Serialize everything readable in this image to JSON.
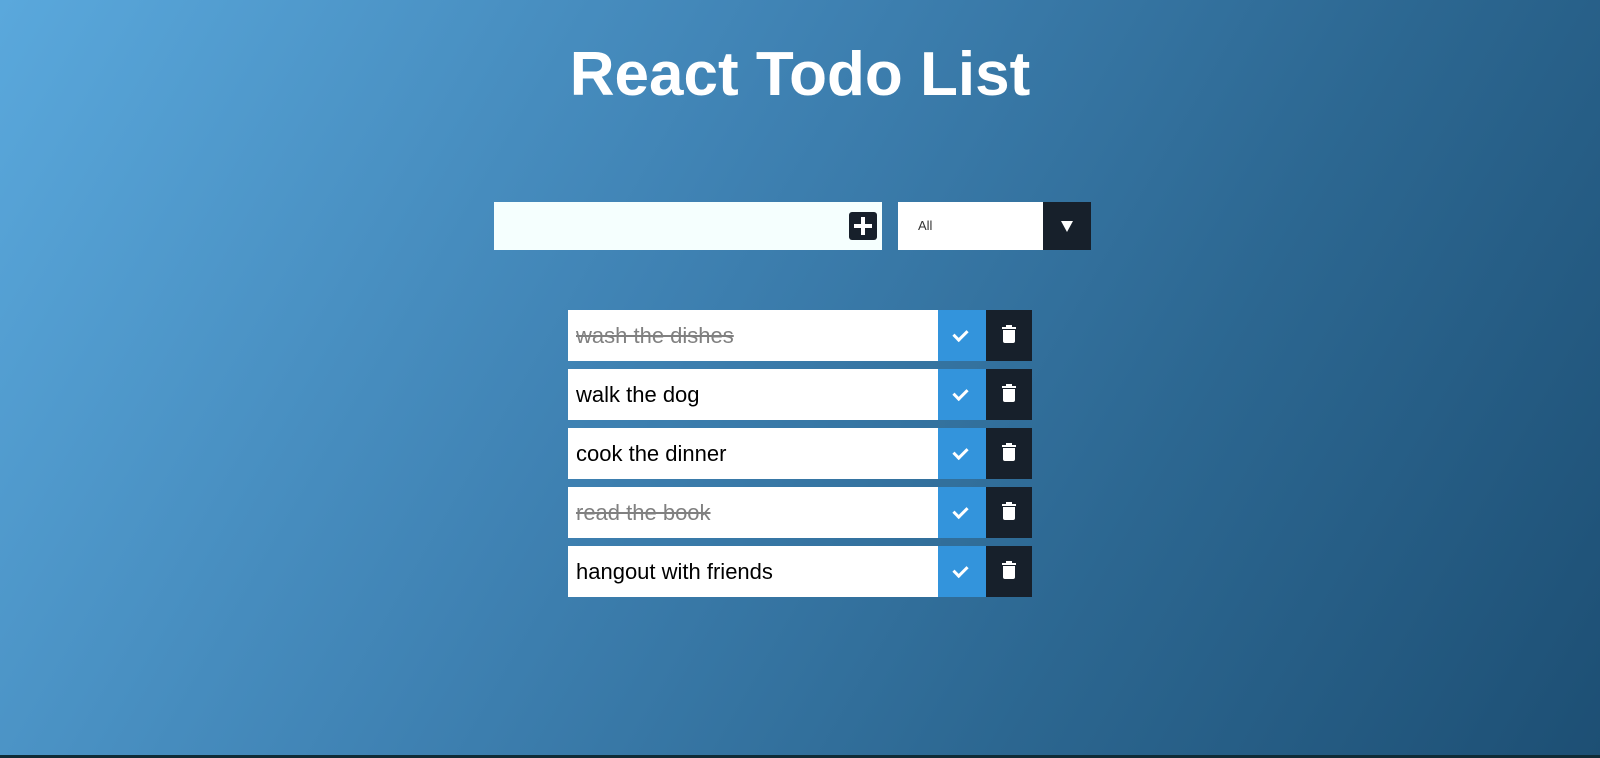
{
  "header": {
    "title": "React Todo List"
  },
  "form": {
    "input_value": "",
    "filter_selected": "All"
  },
  "todos": [
    {
      "text": "wash the dishes",
      "completed": true
    },
    {
      "text": "walk the dog",
      "completed": false
    },
    {
      "text": "cook the dinner",
      "completed": false
    },
    {
      "text": "read the book",
      "completed": true
    },
    {
      "text": "hangout with friends",
      "completed": false
    }
  ],
  "icons": {
    "add": "plus-square-icon",
    "dropdown": "caret-down-icon",
    "complete": "check-icon",
    "delete": "trash-icon"
  },
  "colors": {
    "complete_button": "#3394dc",
    "dark_button": "#17202b",
    "completed_text": "#808080"
  }
}
